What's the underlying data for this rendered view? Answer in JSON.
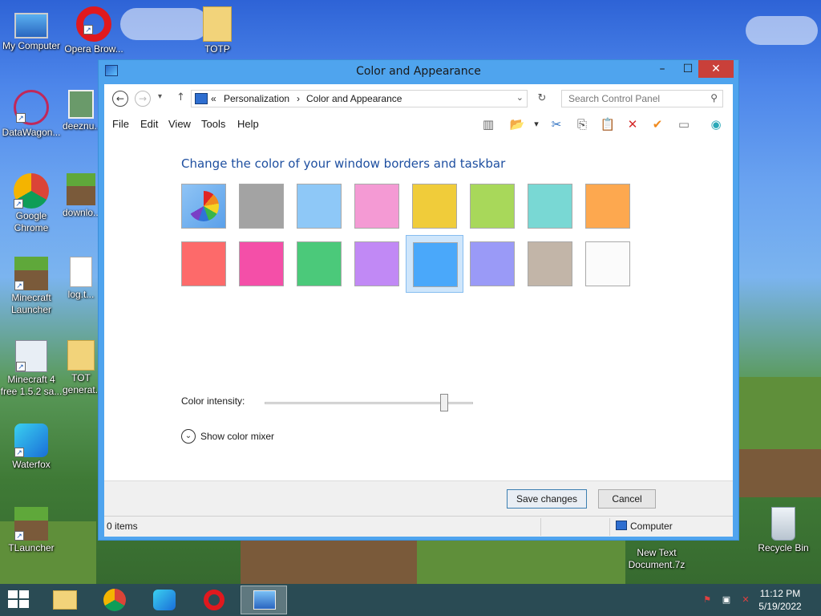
{
  "desktop": {
    "icons": [
      {
        "id": "my-computer",
        "label": "My Computer"
      },
      {
        "id": "opera-browser",
        "label": "Opera Brow..."
      },
      {
        "id": "totp",
        "label": "TOTP"
      },
      {
        "id": "datawagon",
        "label": "DataWagon..."
      },
      {
        "id": "deeznuts",
        "label": "deeznu..."
      },
      {
        "id": "google-chrome",
        "label": "Google Chrome"
      },
      {
        "id": "download",
        "label": "downlo..."
      },
      {
        "id": "minecraft-launcher",
        "label": "Minecraft Launcher"
      },
      {
        "id": "log",
        "label": "log.t..."
      },
      {
        "id": "minecraft-4-free",
        "label": "Minecraft 4 free 1.5.2 sa..."
      },
      {
        "id": "totp-generator",
        "label": "TOT generat..."
      },
      {
        "id": "waterfox",
        "label": "Waterfox"
      },
      {
        "id": "tlauncher",
        "label": "TLauncher"
      },
      {
        "id": "new-text-document",
        "label": "New Text Document.7z"
      },
      {
        "id": "recycle-bin",
        "label": "Recycle Bin"
      }
    ]
  },
  "window": {
    "title": "Color and Appearance",
    "controls": {
      "minimize": "–",
      "maximize": "☐",
      "close": "✕"
    },
    "nav": {
      "back": "←",
      "forward": "→",
      "recent": "▾",
      "up": "↑",
      "address_sep": "«",
      "breadcrumb": [
        "Personalization",
        "Color and Appearance"
      ],
      "breadcrumb_sep": "›",
      "address_dropdown": "⌄",
      "refresh": "↻",
      "search_placeholder": "Search Control Panel",
      "search_icon": "⚲"
    },
    "menu": [
      "File",
      "Edit",
      "View",
      "Tools",
      "Help"
    ],
    "toolbar_icons": [
      "panes-icon",
      "folder-check-icon",
      "dropdown-icon",
      "cut-icon",
      "copy-icon",
      "paste-icon",
      "delete-icon",
      "checkmark-icon",
      "properties-icon",
      "globe-icon"
    ],
    "toolbar_glyphs": {
      "panes": "▥",
      "folder": "📂",
      "dropdown": "▾",
      "cut": "✂",
      "copy": "⎘",
      "paste": "📋",
      "delete": "✕",
      "check": "✔",
      "props": "▭",
      "globe": "◉"
    },
    "content": {
      "heading": "Change the color of your window borders and taskbar",
      "swatches": [
        {
          "name": "automatic",
          "color": "#8fc4f5"
        },
        {
          "name": "gray",
          "color": "#a3a3a3"
        },
        {
          "name": "light-blue",
          "color": "#8ec8f7"
        },
        {
          "name": "pink",
          "color": "#f49ad4"
        },
        {
          "name": "yellow",
          "color": "#f0cc3a"
        },
        {
          "name": "lime",
          "color": "#a8d85a"
        },
        {
          "name": "teal",
          "color": "#79d8d4"
        },
        {
          "name": "orange",
          "color": "#fda84f"
        },
        {
          "name": "red",
          "color": "#fd6a6a"
        },
        {
          "name": "magenta",
          "color": "#f44fa8"
        },
        {
          "name": "green",
          "color": "#4bc97a"
        },
        {
          "name": "purple",
          "color": "#c189f5"
        },
        {
          "name": "blue",
          "color": "#4aa8fa",
          "selected": true
        },
        {
          "name": "periwinkle",
          "color": "#9a9af7"
        },
        {
          "name": "taupe",
          "color": "#c2b5a8"
        },
        {
          "name": "white",
          "color": "#fbfbfb"
        }
      ],
      "intensity_label": "Color intensity:",
      "intensity_value": 0.86,
      "mixer_chevron": "⌄",
      "mixer_label": "Show color mixer"
    },
    "buttons": {
      "save": "Save changes",
      "cancel": "Cancel"
    },
    "status": {
      "items": "0 items",
      "location": "Computer"
    }
  },
  "taskbar": {
    "apps": [
      "file-explorer",
      "google-chrome",
      "waterfox",
      "opera",
      "control-panel"
    ],
    "time": "11:12 PM",
    "date": "5/19/2022",
    "tray_glyphs": {
      "flag": "⚑",
      "network": "▣",
      "volume": "✕"
    }
  }
}
